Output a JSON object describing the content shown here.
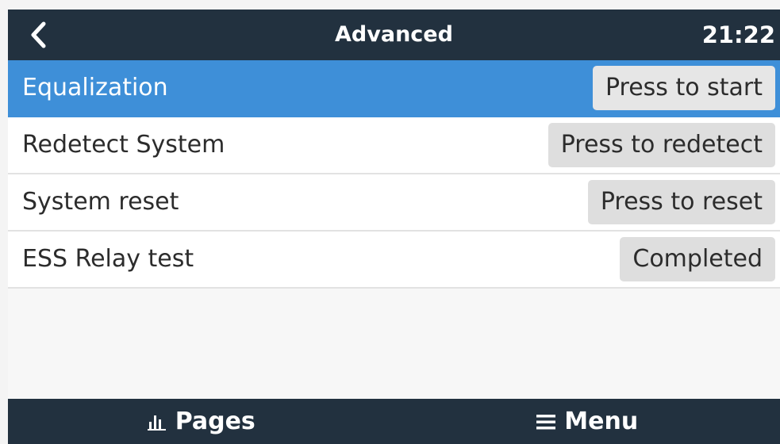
{
  "header": {
    "title": "Advanced",
    "time": "21:22",
    "back_icon": "chevron-left-icon"
  },
  "items": [
    {
      "label": "Equalization",
      "button": "Press to start",
      "selected": true
    },
    {
      "label": "Redetect System",
      "button": "Press to redetect",
      "selected": false
    },
    {
      "label": "System reset",
      "button": "Press to reset",
      "selected": false
    },
    {
      "label": "ESS Relay test",
      "button": "Completed",
      "selected": false
    }
  ],
  "footer": {
    "pages_label": "Pages",
    "pages_icon": "bar-chart-icon",
    "menu_label": "Menu",
    "menu_icon": "hamburger-menu-icon"
  },
  "colors": {
    "header_bg": "#22313f",
    "selected_row": "#3e8fd8",
    "button_bg": "#dedede"
  }
}
